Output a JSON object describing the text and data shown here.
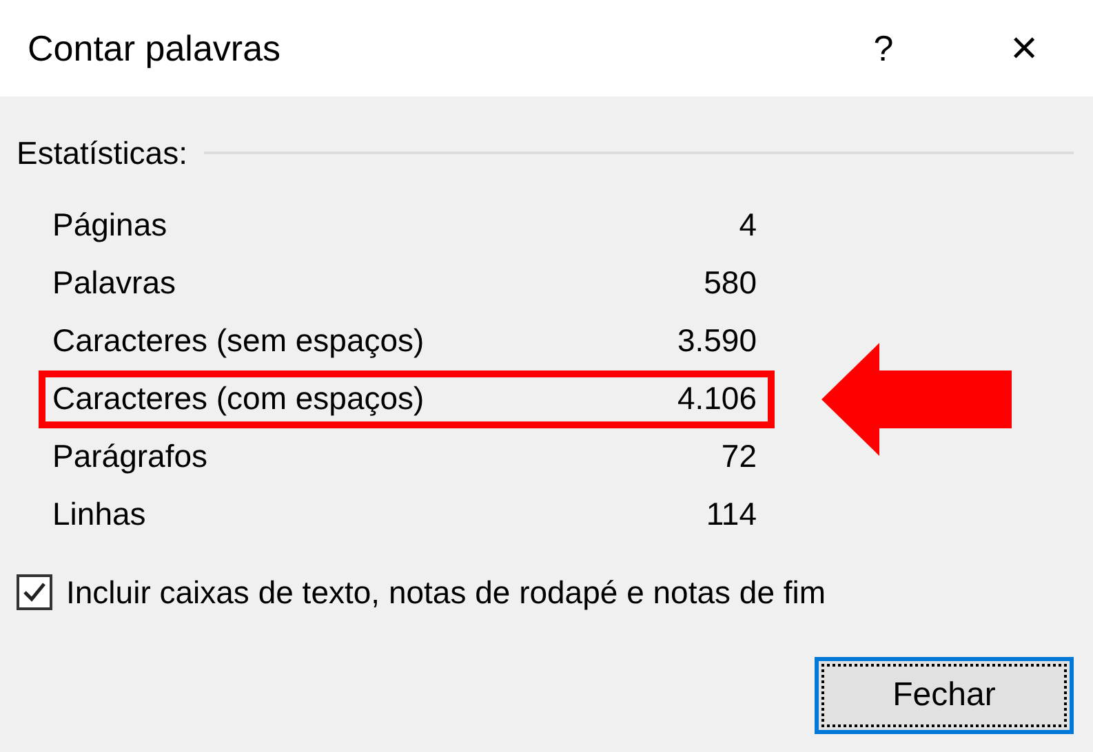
{
  "window": {
    "title": "Contar palavras",
    "help": "?",
    "close": "×"
  },
  "section": {
    "title": "Estatísticas:"
  },
  "rows": [
    {
      "label": "Páginas",
      "value": "4",
      "highlighted": false
    },
    {
      "label": "Palavras",
      "value": "580",
      "highlighted": false
    },
    {
      "label": "Caracteres (sem espaços)",
      "value": "3.590",
      "highlighted": false
    },
    {
      "label": "Caracteres (com espaços)",
      "value": "4.106",
      "highlighted": true
    },
    {
      "label": "Parágrafos",
      "value": "72",
      "highlighted": false
    },
    {
      "label": "Linhas",
      "value": "114",
      "highlighted": false
    }
  ],
  "checkbox": {
    "label": "Incluir caixas de texto, notas de rodapé e notas de fim",
    "checked": true
  },
  "buttons": [
    "Fechar"
  ]
}
